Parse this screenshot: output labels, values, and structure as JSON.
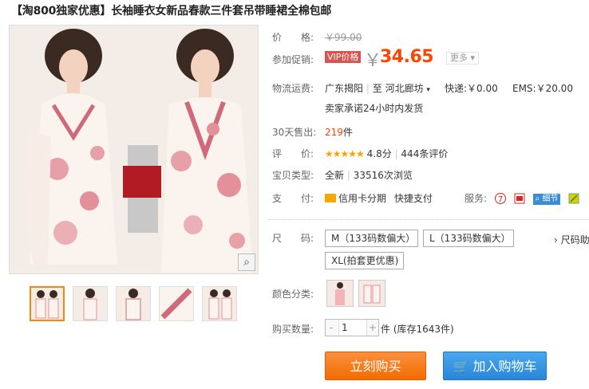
{
  "title": "【淘800独家优惠】长袖睡衣女新品春款三件套吊带睡裙全棉包邮",
  "price": {
    "label": "价　　格:",
    "original": "￥99.00"
  },
  "promo": {
    "label": "参加促销:",
    "vip": "VIP价格",
    "yen": "￥",
    "price": "34.65",
    "more": "更多"
  },
  "shipping": {
    "label": "物流运费:",
    "from": "广东揭阳",
    "to_sep": "至",
    "to": "河北廊坊",
    "express": "快递:￥0.00",
    "ems": "EMS:￥20.00",
    "note": "卖家承诺24小时内发货"
  },
  "sales": {
    "label": "30天售出:",
    "count": "219",
    "unit": "件"
  },
  "rating": {
    "label": "评　　价:",
    "stars": "★★★★★",
    "score": "4.8分",
    "reviews": "444条评价"
  },
  "condition": {
    "label": "宝贝类型:",
    "value": "全新",
    "views": "33516次浏览"
  },
  "payment": {
    "label": "支　　付:",
    "installment": "信用卡分期",
    "quickpay": "快捷支付",
    "services_label": "服务:",
    "detail": "细节",
    "icon_names": [
      "credit-card-icon",
      "seven-day-return-icon",
      "genuine-guarantee-icon",
      "detail-magnifier-icon",
      "arrow-service-icon"
    ]
  },
  "size": {
    "label": "尺　　码:",
    "options": [
      "M（133码数偏大）",
      "L（133码数偏大）",
      "XL(拍套更优惠)"
    ],
    "chart": "› 尺码助"
  },
  "color": {
    "label": "颜色分类:"
  },
  "quantity": {
    "label": "购买数量:",
    "value": "1",
    "minus": "-",
    "plus": "+",
    "stock": "件 (库存1643件)"
  },
  "buttons": {
    "buy": "立刻购买",
    "cart": "加入购物车"
  },
  "colors": {
    "accent": "#ff4400",
    "buy": "#f26d00",
    "cart": "#2a86d8",
    "vip": "#d9534f",
    "stars": "#f7a300"
  }
}
